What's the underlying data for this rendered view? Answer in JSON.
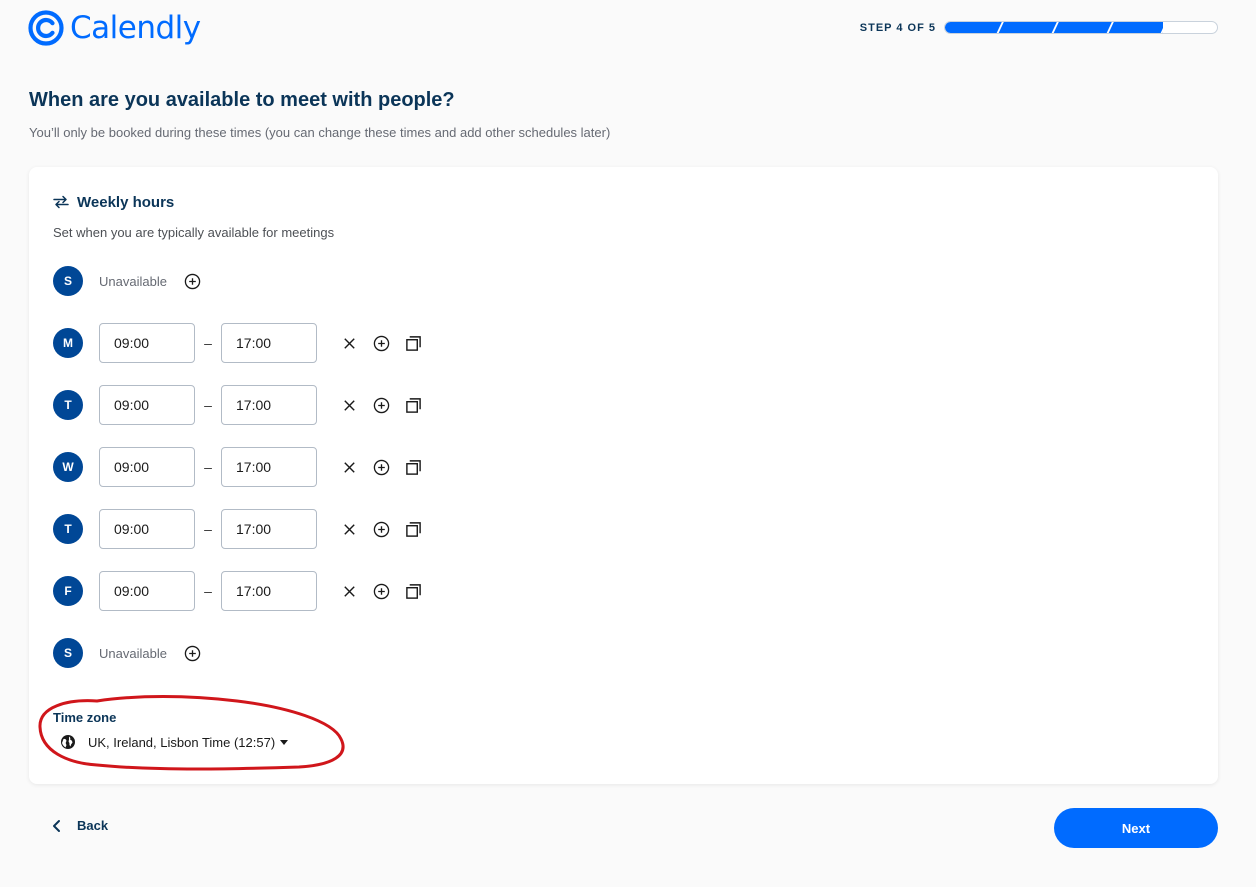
{
  "brand": {
    "name": "Calendly",
    "color": "#006bff",
    "logo_icon": "calendly-logo-icon"
  },
  "progress": {
    "label": "STEP 4 OF 5",
    "current": 4,
    "total": 5
  },
  "page": {
    "title": "When are you available to meet with people?",
    "subtitle": "You’ll only be booked during these times (you can change these times and add other schedules later)"
  },
  "weekly": {
    "icon": "repeat-arrows-icon",
    "title": "Weekly hours",
    "subtitle": "Set when you are typically available for meetings",
    "days": [
      {
        "letter": "S",
        "available": false,
        "status": "Unavailable"
      },
      {
        "letter": "M",
        "available": true,
        "start": "09:00",
        "end": "17:00"
      },
      {
        "letter": "T",
        "available": true,
        "start": "09:00",
        "end": "17:00"
      },
      {
        "letter": "W",
        "available": true,
        "start": "09:00",
        "end": "17:00"
      },
      {
        "letter": "T",
        "available": true,
        "start": "09:00",
        "end": "17:00"
      },
      {
        "letter": "F",
        "available": true,
        "start": "09:00",
        "end": "17:00"
      },
      {
        "letter": "S",
        "available": false,
        "status": "Unavailable"
      }
    ],
    "separator": "–"
  },
  "timezone": {
    "label": "Time zone",
    "icon": "globe-icon",
    "value": "UK, Ireland, Lisbon Time (12:57)"
  },
  "annotation_color": "#d0161b",
  "footer": {
    "back_label": "Back",
    "next_label": "Next"
  }
}
